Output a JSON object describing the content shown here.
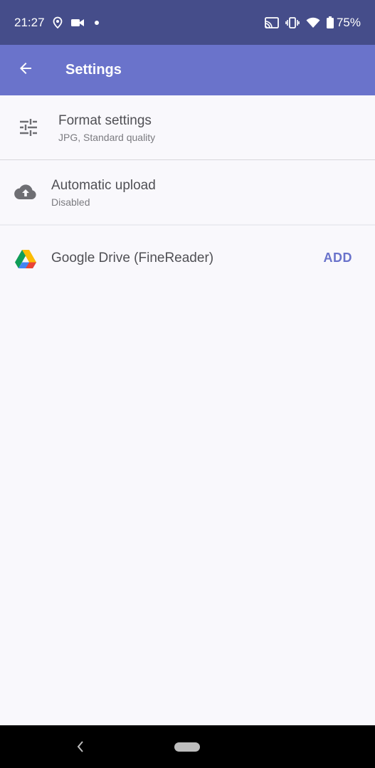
{
  "status_bar": {
    "time": "21:27",
    "battery_percent": "75%",
    "icons": [
      "location-icon",
      "video-icon",
      "dot-icon",
      "cast-icon",
      "vibrate-icon",
      "wifi-icon",
      "battery-icon"
    ]
  },
  "app_bar": {
    "title": "Settings",
    "back_icon": "arrow-left-icon"
  },
  "settings": {
    "format": {
      "title": "Format settings",
      "subtitle": "JPG, Standard quality",
      "icon": "tune-icon"
    },
    "upload": {
      "title": "Automatic upload",
      "subtitle": "Disabled",
      "icon": "cloud-upload-icon"
    },
    "account": {
      "label": "Google Drive (FineReader)",
      "action": "ADD",
      "icon": "google-drive-icon"
    }
  },
  "colors": {
    "status_bar": "#454d8a",
    "app_bar": "#6a73cb",
    "accent": "#6a73cb",
    "background": "#f9f8fc"
  }
}
